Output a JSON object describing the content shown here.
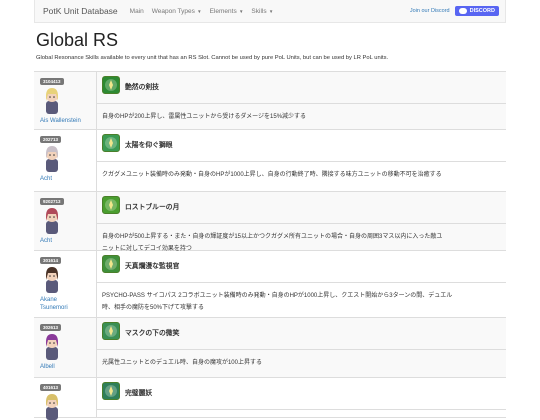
{
  "navbar": {
    "brand": "PotK Unit Database",
    "items": [
      {
        "label": "Main"
      },
      {
        "label": "Weapon Types"
      },
      {
        "label": "Elements"
      },
      {
        "label": "Skills"
      }
    ],
    "join_label": "Join our Discord",
    "discord_label": "DISCORD"
  },
  "page": {
    "title": "Global RS",
    "description": "Global Resonance Skills available to every unit that has an RS Slot. Cannot be used by pure PoL Units, but can be used by LR PoL units."
  },
  "rows": [
    {
      "unit_id": "3104413",
      "unit_name_lines": [
        "Ais Wallenstein"
      ],
      "skill_name": "艶然の剣技",
      "skill_desc_lines": [
        "自身のHPが200上昇し、雷属性ユニットから受けるダメージを15%減少する"
      ],
      "icon_bg": "#2d8a33",
      "hair_color": "#e8d27a"
    },
    {
      "unit_id": "202713",
      "unit_name_lines": [
        "Acht"
      ],
      "skill_name": "太陽を仰ぐ獅眼",
      "skill_desc_lines": [
        "クガグメユニット装備時のみ発動・自身のHPが1000上昇し、自身の行動終了時、隣接する味方ユニットの移動不可を治癒する"
      ],
      "icon_bg": "#3a9a52",
      "hair_color": "#c9c0c8"
    },
    {
      "unit_id": "9202713",
      "unit_name_lines": [
        "Acht"
      ],
      "skill_name": "ロストブルーの月",
      "skill_desc_lines": [
        "自身のHPが500上昇する・また・自身の輝証度が15以上かつクガグメ所有ユニットの場合・自身の周囲3マス以内に入った敵ユ",
        "ニットに対してデコイ効果を持つ"
      ],
      "icon_bg": "#4a9e2f",
      "hair_color": "#b04a5a"
    },
    {
      "unit_id": "301614",
      "unit_name_lines": [
        "Akane",
        "Tsunemori"
      ],
      "skill_name": "天真爛漫な監視官",
      "skill_desc_lines": [
        "PSYCHO-PASS サイコパス 2コラボユニット装備時のみ発動・自身のHPが1000上昇し、クエスト開始から3ターンの間、デュエル",
        "時、相手の魔防を50%下げて攻撃する"
      ],
      "icon_bg": "#3f8f3a",
      "hair_color": "#4a3328"
    },
    {
      "unit_id": "302613",
      "unit_name_lines": [
        "Albell"
      ],
      "skill_name": "マスクの下の微笑",
      "skill_desc_lines": [
        "光属性ユニットとのデュエル時、自身の魔攻が100上昇する"
      ],
      "icon_bg": "#3a8f55",
      "hair_color": "#8a3a9a"
    },
    {
      "unit_id": "401613",
      "unit_name_lines": [],
      "skill_name": "完璧麗妖",
      "skill_desc_lines": [],
      "icon_bg": "#2f7f5a",
      "hair_color": "#d8c06a"
    }
  ]
}
